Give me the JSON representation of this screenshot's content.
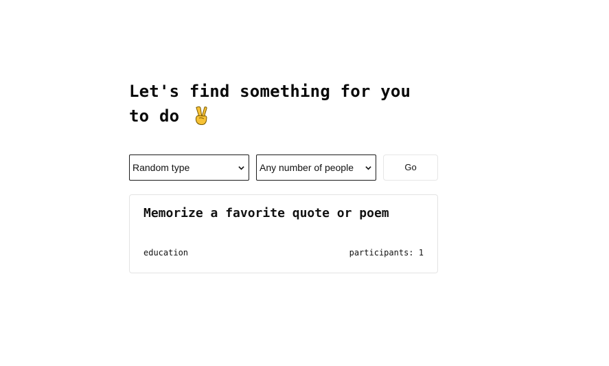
{
  "header": {
    "title": "Let's find something for you to do"
  },
  "controls": {
    "type_select": {
      "selected": "Random type",
      "icon": "chevron-down-icon"
    },
    "people_select": {
      "selected": "Any number of people",
      "icon": "chevron-down-icon"
    },
    "go_label": "Go"
  },
  "activity_card": {
    "activity": "Memorize a favorite quote or poem",
    "type": "education",
    "participants_label": "participants:",
    "participants": "1"
  },
  "icons": {
    "title_emoji": "victory-hand-icon"
  },
  "colors": {
    "text": "#111111",
    "select_border": "#1a1a1a",
    "card_border": "#e3e3e3",
    "button_border": "#e6e6e6",
    "emoji_fill": "#f7c236"
  }
}
